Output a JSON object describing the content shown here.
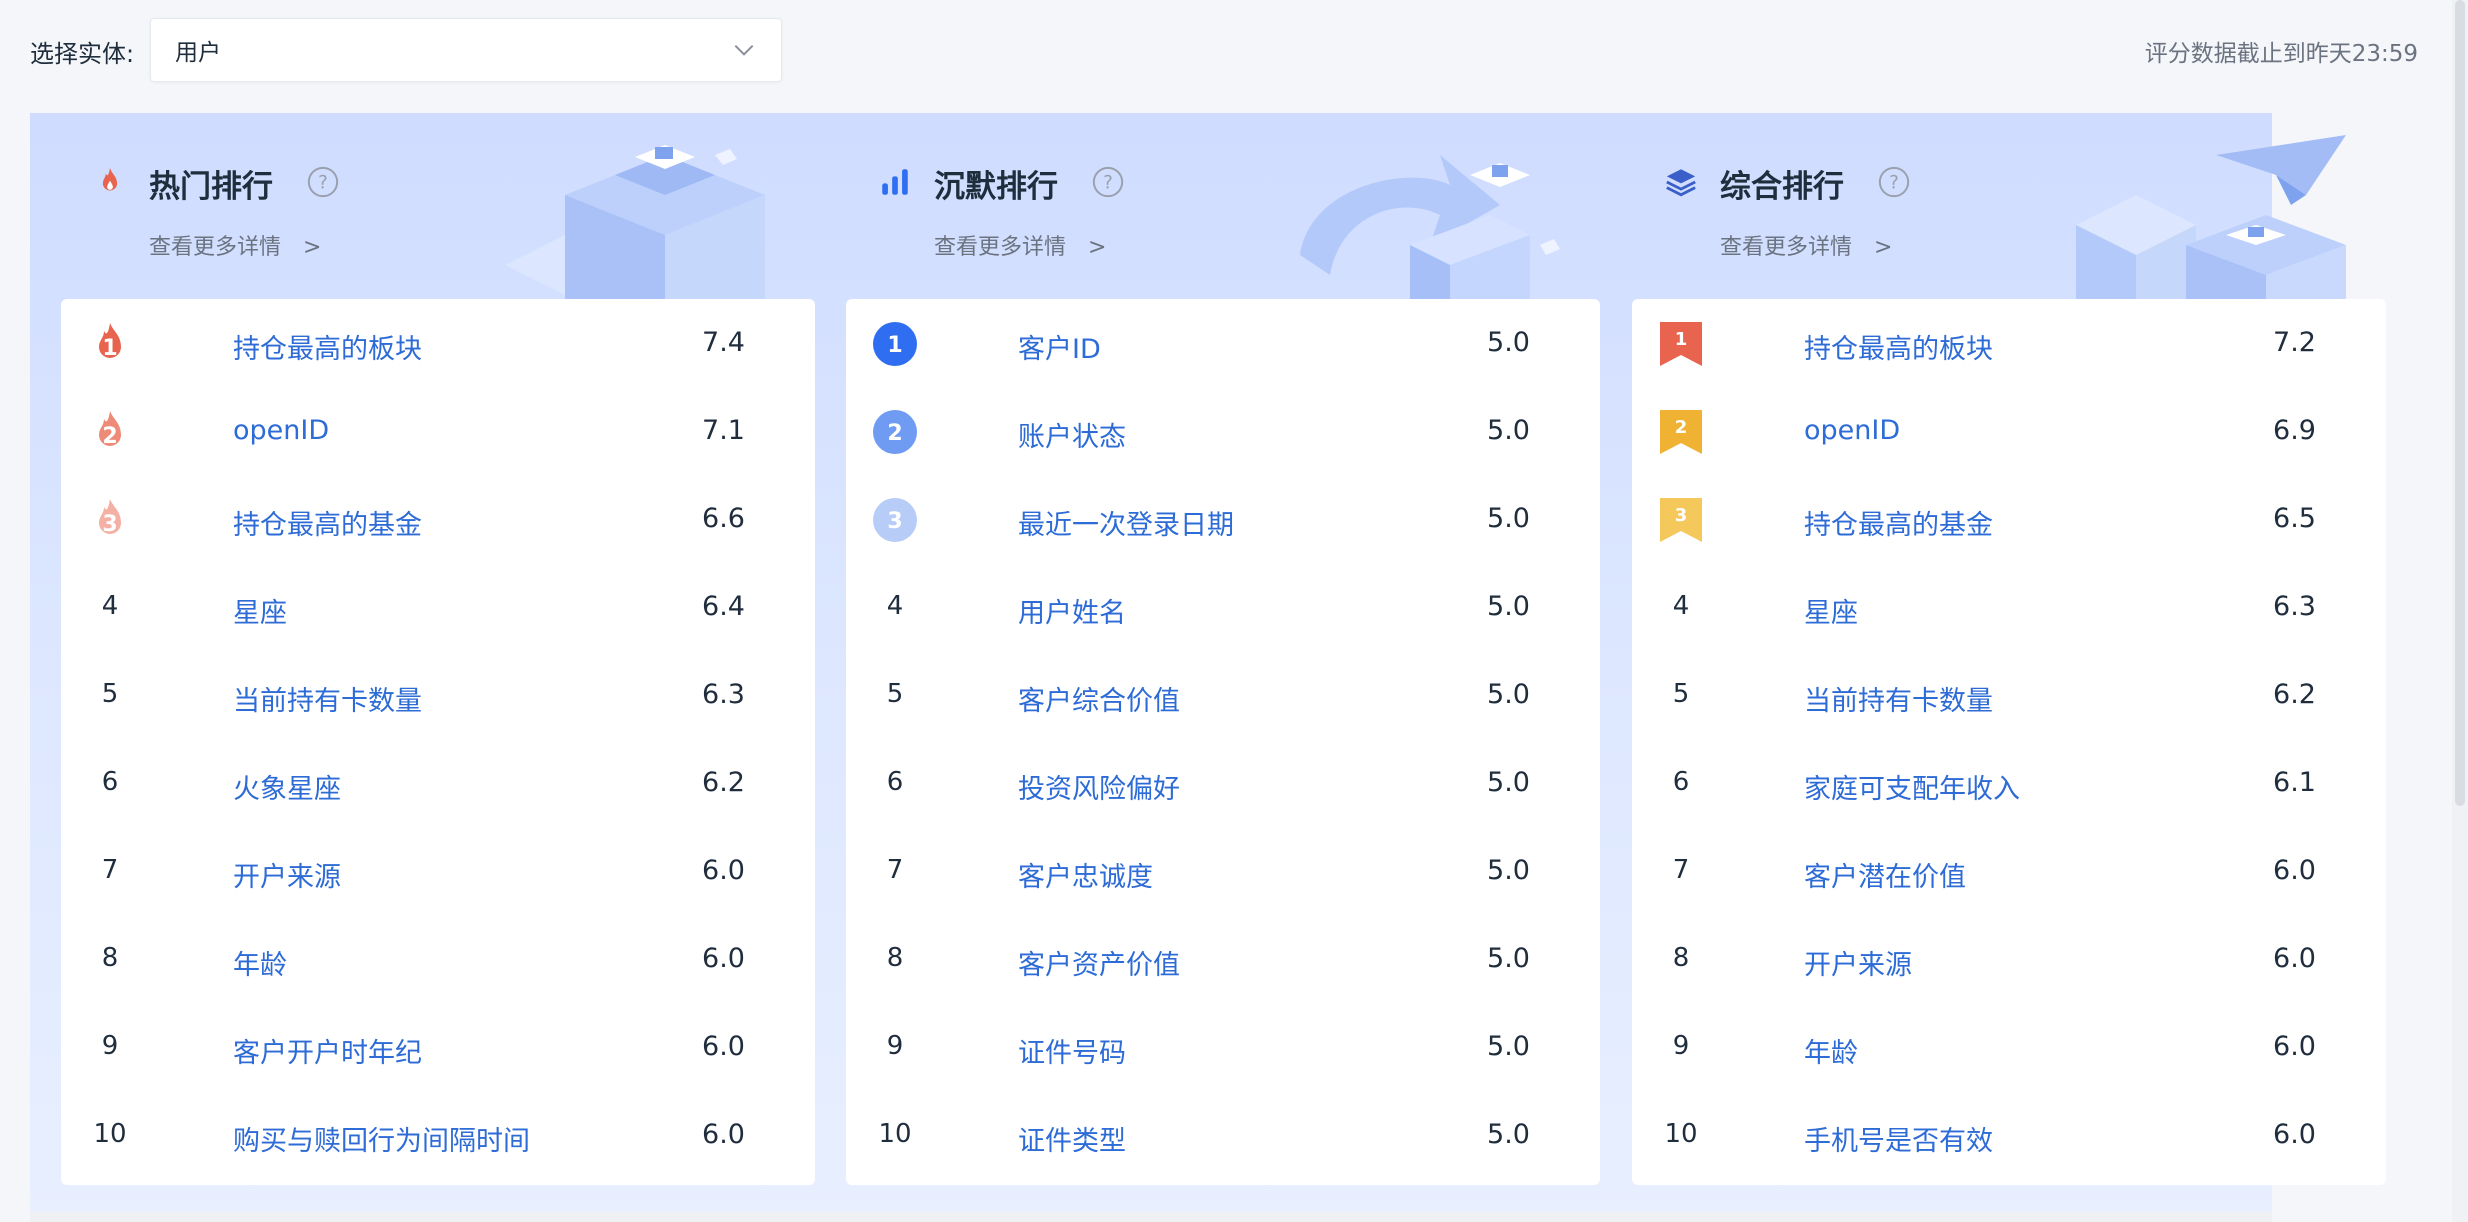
{
  "header": {
    "entity_label": "选择实体:",
    "entity_value": "用户",
    "data_note": "评分数据截止到昨天23:59"
  },
  "colors": {
    "accent_blue": "#2d6bd6",
    "fire_1": "#e8644f",
    "fire_2": "#ee8a78",
    "fire_3": "#f4b0a4",
    "circle_1": "#2f6ef0",
    "circle_2": "#6f9bf2",
    "circle_3": "#b7cdf8",
    "ribbon_1": "#e8644f",
    "ribbon_2": "#f0b233",
    "ribbon_3": "#f5c85b"
  },
  "columns": [
    {
      "title": "热门排行",
      "icon": "flame-icon",
      "more": "查看更多详情",
      "more_arrow": ">",
      "badge_style": "fire",
      "rows": [
        {
          "rank": "1",
          "name": "持仓最高的板块",
          "score": "7.4"
        },
        {
          "rank": "2",
          "name": "openID",
          "score": "7.1"
        },
        {
          "rank": "3",
          "name": "持仓最高的基金",
          "score": "6.6"
        },
        {
          "rank": "4",
          "name": "星座",
          "score": "6.4"
        },
        {
          "rank": "5",
          "name": "当前持有卡数量",
          "score": "6.3"
        },
        {
          "rank": "6",
          "name": "火象星座",
          "score": "6.2"
        },
        {
          "rank": "7",
          "name": "开户来源",
          "score": "6.0"
        },
        {
          "rank": "8",
          "name": "年龄",
          "score": "6.0"
        },
        {
          "rank": "9",
          "name": "客户开户时年纪",
          "score": "6.0"
        },
        {
          "rank": "10",
          "name": "购买与赎回行为间隔时间",
          "score": "6.0"
        }
      ]
    },
    {
      "title": "沉默排行",
      "icon": "bar-chart-icon",
      "more": "查看更多详情",
      "more_arrow": ">",
      "badge_style": "circle",
      "rows": [
        {
          "rank": "1",
          "name": "客户ID",
          "score": "5.0"
        },
        {
          "rank": "2",
          "name": "账户状态",
          "score": "5.0"
        },
        {
          "rank": "3",
          "name": "最近一次登录日期",
          "score": "5.0"
        },
        {
          "rank": "4",
          "name": "用户姓名",
          "score": "5.0"
        },
        {
          "rank": "5",
          "name": "客户综合价值",
          "score": "5.0"
        },
        {
          "rank": "6",
          "name": "投资风险偏好",
          "score": "5.0"
        },
        {
          "rank": "7",
          "name": "客户忠诚度",
          "score": "5.0"
        },
        {
          "rank": "8",
          "name": "客户资产价值",
          "score": "5.0"
        },
        {
          "rank": "9",
          "name": "证件号码",
          "score": "5.0"
        },
        {
          "rank": "10",
          "name": "证件类型",
          "score": "5.0"
        }
      ]
    },
    {
      "title": "综合排行",
      "icon": "layers-icon",
      "more": "查看更多详情",
      "more_arrow": ">",
      "badge_style": "ribbon",
      "rows": [
        {
          "rank": "1",
          "name": "持仓最高的板块",
          "score": "7.2"
        },
        {
          "rank": "2",
          "name": "openID",
          "score": "6.9"
        },
        {
          "rank": "3",
          "name": "持仓最高的基金",
          "score": "6.5"
        },
        {
          "rank": "4",
          "name": "星座",
          "score": "6.3"
        },
        {
          "rank": "5",
          "name": "当前持有卡数量",
          "score": "6.2"
        },
        {
          "rank": "6",
          "name": "家庭可支配年收入",
          "score": "6.1"
        },
        {
          "rank": "7",
          "name": "客户潜在价值",
          "score": "6.0"
        },
        {
          "rank": "8",
          "name": "开户来源",
          "score": "6.0"
        },
        {
          "rank": "9",
          "name": "年龄",
          "score": "6.0"
        },
        {
          "rank": "10",
          "name": "手机号是否有效",
          "score": "6.0"
        }
      ]
    }
  ]
}
